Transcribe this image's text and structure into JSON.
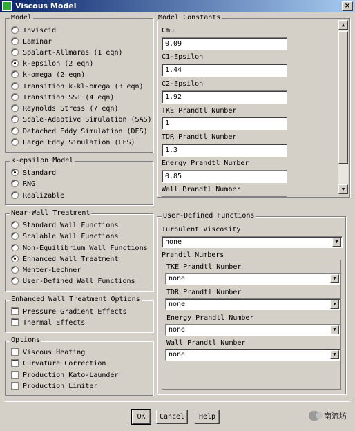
{
  "window": {
    "title": "Viscous Model",
    "close_glyph": "×"
  },
  "model": {
    "legend": "Model",
    "options": [
      {
        "label": "Inviscid",
        "selected": false
      },
      {
        "label": "Laminar",
        "selected": false
      },
      {
        "label": "Spalart-Allmaras (1 eqn)",
        "selected": false
      },
      {
        "label": "k-epsilon (2 eqn)",
        "selected": true
      },
      {
        "label": "k-omega (2 eqn)",
        "selected": false
      },
      {
        "label": "Transition k-kl-omega (3 eqn)",
        "selected": false
      },
      {
        "label": "Transition SST (4 eqn)",
        "selected": false
      },
      {
        "label": "Reynolds Stress (7 eqn)",
        "selected": false
      },
      {
        "label": "Scale-Adaptive Simulation (SAS)",
        "selected": false
      },
      {
        "label": "Detached Eddy Simulation (DES)",
        "selected": false
      },
      {
        "label": "Large Eddy Simulation (LES)",
        "selected": false
      }
    ]
  },
  "kepsilon": {
    "legend": "k-epsilon Model",
    "options": [
      {
        "label": "Standard",
        "selected": true
      },
      {
        "label": "RNG",
        "selected": false
      },
      {
        "label": "Realizable",
        "selected": false
      }
    ]
  },
  "nearwall": {
    "legend": "Near-Wall Treatment",
    "options": [
      {
        "label": "Standard Wall Functions",
        "selected": false
      },
      {
        "label": "Scalable Wall Functions",
        "selected": false
      },
      {
        "label": "Non-Equilibrium Wall Functions",
        "selected": false
      },
      {
        "label": "Enhanced Wall Treatment",
        "selected": true
      },
      {
        "label": "Menter-Lechner",
        "selected": false
      },
      {
        "label": "User-Defined Wall Functions",
        "selected": false
      }
    ]
  },
  "ewt": {
    "legend": "Enhanced Wall Treatment Options",
    "options": [
      {
        "label": "Pressure Gradient Effects",
        "checked": false
      },
      {
        "label": "Thermal Effects",
        "checked": false
      }
    ]
  },
  "options": {
    "legend": "Options",
    "items": [
      {
        "label": "Viscous Heating",
        "checked": false
      },
      {
        "label": "Curvature Correction",
        "checked": false
      },
      {
        "label": "Production Kato-Launder",
        "checked": false
      },
      {
        "label": "Production Limiter",
        "checked": false
      }
    ]
  },
  "constants": {
    "legend": "Model Constants",
    "items": [
      {
        "label": "Cmu",
        "value": "0.09"
      },
      {
        "label": "C1-Epsilon",
        "value": "1.44"
      },
      {
        "label": "C2-Epsilon",
        "value": "1.92"
      },
      {
        "label": "TKE Prandtl Number",
        "value": "1"
      },
      {
        "label": "TDR Prandtl Number",
        "value": "1.3"
      },
      {
        "label": "Energy Prandtl Number",
        "value": "0.85"
      },
      {
        "label": "Wall Prandtl Number",
        "value": ""
      }
    ],
    "scroll_up": "▲",
    "scroll_down": "▼"
  },
  "udf": {
    "legend": "User-Defined Functions",
    "turbulent_viscosity_label": "Turbulent Viscosity",
    "turbulent_viscosity_value": "none",
    "prandtl_legend": "Prandtl Numbers",
    "prandtl": [
      {
        "label": "TKE Prandtl Number",
        "value": "none"
      },
      {
        "label": "TDR Prandtl Number",
        "value": "none"
      },
      {
        "label": "Energy Prandtl Number",
        "value": "none"
      },
      {
        "label": "Wall Prandtl Number",
        "value": "none"
      }
    ],
    "arrow": "▼"
  },
  "buttons": {
    "ok": "OK",
    "cancel": "Cancel",
    "help": "Help"
  },
  "watermark": {
    "text": "南流坊"
  }
}
